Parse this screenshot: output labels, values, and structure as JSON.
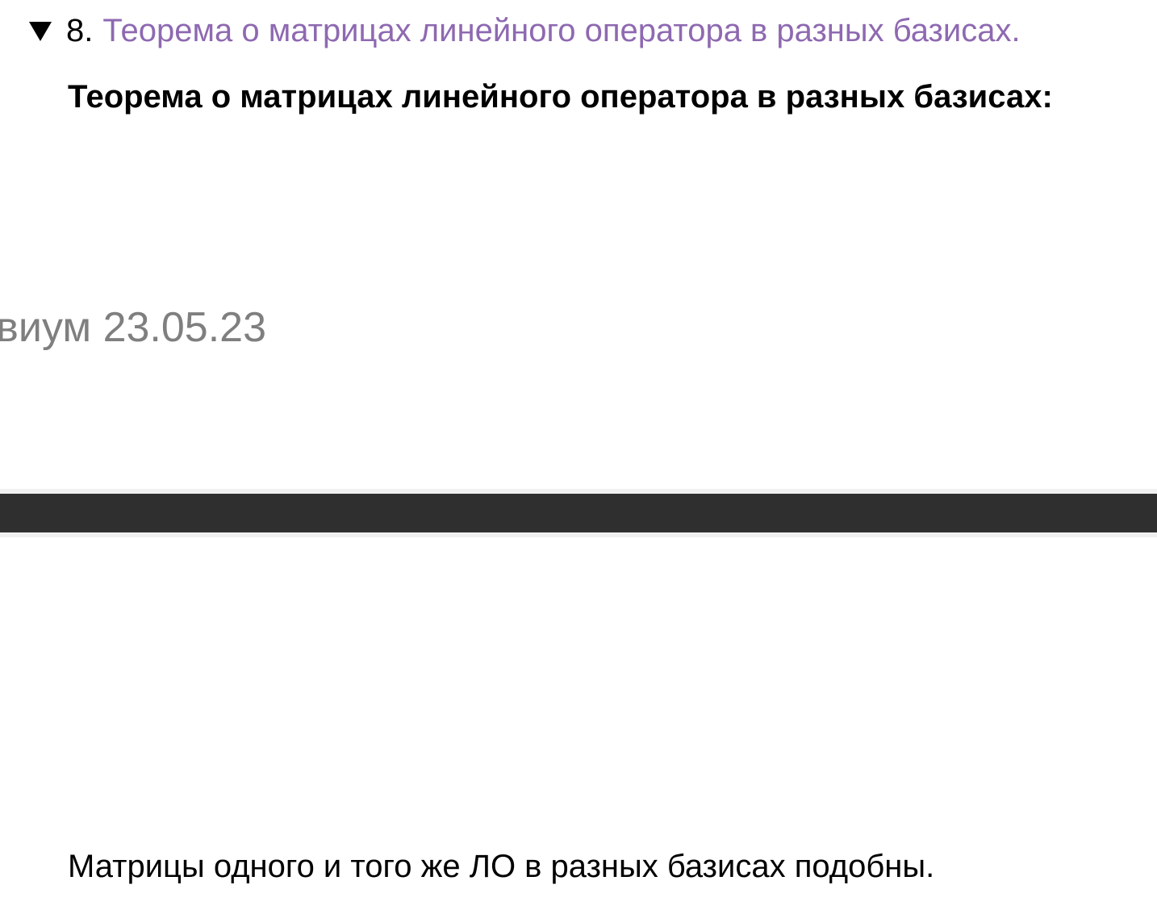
{
  "section": {
    "number": "8.",
    "link_text": "Теорема о матрицах линейного оператора в разных базисах.",
    "link_color": "#8e69b1",
    "toggle_icon": "triangle-down-icon"
  },
  "content": {
    "heading": "Теорема о матрицах линейного оператора в разных базисах:",
    "watermark": "виум 23.05.23",
    "statement": "Матрицы одного и того же ЛО в разных базисах подобны."
  }
}
